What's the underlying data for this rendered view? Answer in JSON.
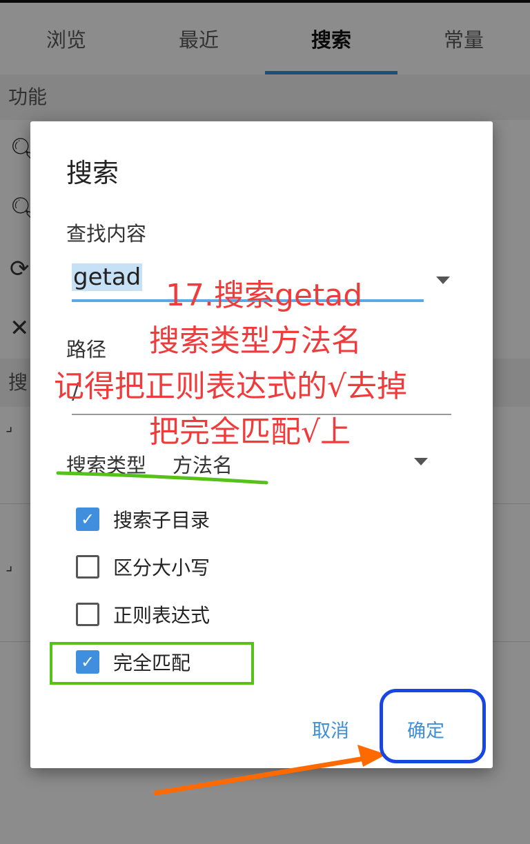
{
  "tabs": [
    {
      "label": "浏览"
    },
    {
      "label": "最近"
    },
    {
      "label": "搜索"
    },
    {
      "label": "常量"
    }
  ],
  "active_tab": "搜索",
  "background": {
    "section_header": "功能",
    "section2_header": "搜"
  },
  "dialog": {
    "title": "搜索",
    "query_label": "查找内容",
    "query_value": "getad",
    "path_label": "路径",
    "path_value": "/",
    "type_label": "搜索类型",
    "type_value": "方法名",
    "options": [
      {
        "label": "搜索子目录",
        "checked": true
      },
      {
        "label": "区分大小写",
        "checked": false
      },
      {
        "label": "正则表达式",
        "checked": false
      },
      {
        "label": "完全匹配",
        "checked": true
      }
    ],
    "cancel_label": "取消",
    "ok_label": "确定"
  },
  "annotations": {
    "lines": [
      "17.搜索getad",
      "搜索类型方法名",
      "记得把正则表达式的√去掉",
      "把完全匹配√上"
    ]
  },
  "colors": {
    "accent": "#3f8fde",
    "annotation_text": "#ef3b3b",
    "green_mark": "#55c21a",
    "blue_mark": "#1746e0",
    "arrow": "#ff6a00"
  }
}
